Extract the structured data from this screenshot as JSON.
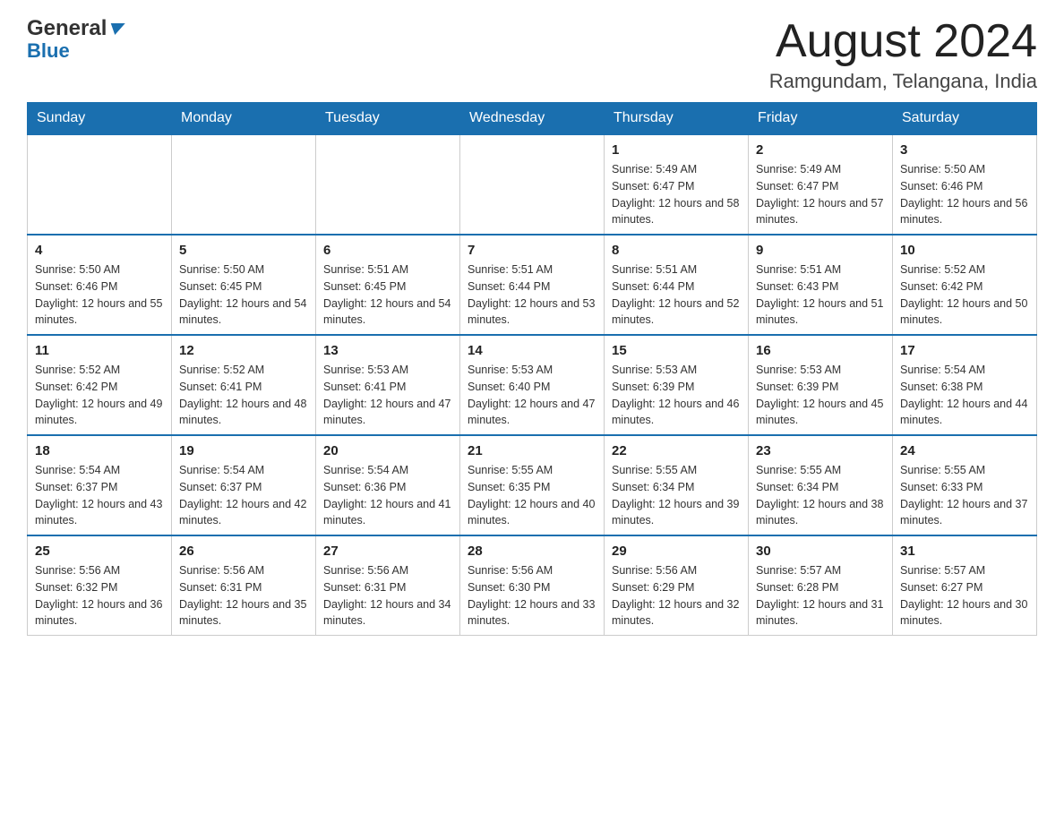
{
  "logo": {
    "general": "General",
    "blue": "Blue",
    "arrow_alt": "logo-arrow"
  },
  "header": {
    "title": "August 2024",
    "location": "Ramgundam, Telangana, India"
  },
  "weekdays": [
    "Sunday",
    "Monday",
    "Tuesday",
    "Wednesday",
    "Thursday",
    "Friday",
    "Saturday"
  ],
  "weeks": [
    {
      "days": [
        {
          "number": "",
          "sunrise": "",
          "sunset": "",
          "daylight": ""
        },
        {
          "number": "",
          "sunrise": "",
          "sunset": "",
          "daylight": ""
        },
        {
          "number": "",
          "sunrise": "",
          "sunset": "",
          "daylight": ""
        },
        {
          "number": "",
          "sunrise": "",
          "sunset": "",
          "daylight": ""
        },
        {
          "number": "1",
          "sunrise": "Sunrise: 5:49 AM",
          "sunset": "Sunset: 6:47 PM",
          "daylight": "Daylight: 12 hours and 58 minutes."
        },
        {
          "number": "2",
          "sunrise": "Sunrise: 5:49 AM",
          "sunset": "Sunset: 6:47 PM",
          "daylight": "Daylight: 12 hours and 57 minutes."
        },
        {
          "number": "3",
          "sunrise": "Sunrise: 5:50 AM",
          "sunset": "Sunset: 6:46 PM",
          "daylight": "Daylight: 12 hours and 56 minutes."
        }
      ]
    },
    {
      "days": [
        {
          "number": "4",
          "sunrise": "Sunrise: 5:50 AM",
          "sunset": "Sunset: 6:46 PM",
          "daylight": "Daylight: 12 hours and 55 minutes."
        },
        {
          "number": "5",
          "sunrise": "Sunrise: 5:50 AM",
          "sunset": "Sunset: 6:45 PM",
          "daylight": "Daylight: 12 hours and 54 minutes."
        },
        {
          "number": "6",
          "sunrise": "Sunrise: 5:51 AM",
          "sunset": "Sunset: 6:45 PM",
          "daylight": "Daylight: 12 hours and 54 minutes."
        },
        {
          "number": "7",
          "sunrise": "Sunrise: 5:51 AM",
          "sunset": "Sunset: 6:44 PM",
          "daylight": "Daylight: 12 hours and 53 minutes."
        },
        {
          "number": "8",
          "sunrise": "Sunrise: 5:51 AM",
          "sunset": "Sunset: 6:44 PM",
          "daylight": "Daylight: 12 hours and 52 minutes."
        },
        {
          "number": "9",
          "sunrise": "Sunrise: 5:51 AM",
          "sunset": "Sunset: 6:43 PM",
          "daylight": "Daylight: 12 hours and 51 minutes."
        },
        {
          "number": "10",
          "sunrise": "Sunrise: 5:52 AM",
          "sunset": "Sunset: 6:42 PM",
          "daylight": "Daylight: 12 hours and 50 minutes."
        }
      ]
    },
    {
      "days": [
        {
          "number": "11",
          "sunrise": "Sunrise: 5:52 AM",
          "sunset": "Sunset: 6:42 PM",
          "daylight": "Daylight: 12 hours and 49 minutes."
        },
        {
          "number": "12",
          "sunrise": "Sunrise: 5:52 AM",
          "sunset": "Sunset: 6:41 PM",
          "daylight": "Daylight: 12 hours and 48 minutes."
        },
        {
          "number": "13",
          "sunrise": "Sunrise: 5:53 AM",
          "sunset": "Sunset: 6:41 PM",
          "daylight": "Daylight: 12 hours and 47 minutes."
        },
        {
          "number": "14",
          "sunrise": "Sunrise: 5:53 AM",
          "sunset": "Sunset: 6:40 PM",
          "daylight": "Daylight: 12 hours and 47 minutes."
        },
        {
          "number": "15",
          "sunrise": "Sunrise: 5:53 AM",
          "sunset": "Sunset: 6:39 PM",
          "daylight": "Daylight: 12 hours and 46 minutes."
        },
        {
          "number": "16",
          "sunrise": "Sunrise: 5:53 AM",
          "sunset": "Sunset: 6:39 PM",
          "daylight": "Daylight: 12 hours and 45 minutes."
        },
        {
          "number": "17",
          "sunrise": "Sunrise: 5:54 AM",
          "sunset": "Sunset: 6:38 PM",
          "daylight": "Daylight: 12 hours and 44 minutes."
        }
      ]
    },
    {
      "days": [
        {
          "number": "18",
          "sunrise": "Sunrise: 5:54 AM",
          "sunset": "Sunset: 6:37 PM",
          "daylight": "Daylight: 12 hours and 43 minutes."
        },
        {
          "number": "19",
          "sunrise": "Sunrise: 5:54 AM",
          "sunset": "Sunset: 6:37 PM",
          "daylight": "Daylight: 12 hours and 42 minutes."
        },
        {
          "number": "20",
          "sunrise": "Sunrise: 5:54 AM",
          "sunset": "Sunset: 6:36 PM",
          "daylight": "Daylight: 12 hours and 41 minutes."
        },
        {
          "number": "21",
          "sunrise": "Sunrise: 5:55 AM",
          "sunset": "Sunset: 6:35 PM",
          "daylight": "Daylight: 12 hours and 40 minutes."
        },
        {
          "number": "22",
          "sunrise": "Sunrise: 5:55 AM",
          "sunset": "Sunset: 6:34 PM",
          "daylight": "Daylight: 12 hours and 39 minutes."
        },
        {
          "number": "23",
          "sunrise": "Sunrise: 5:55 AM",
          "sunset": "Sunset: 6:34 PM",
          "daylight": "Daylight: 12 hours and 38 minutes."
        },
        {
          "number": "24",
          "sunrise": "Sunrise: 5:55 AM",
          "sunset": "Sunset: 6:33 PM",
          "daylight": "Daylight: 12 hours and 37 minutes."
        }
      ]
    },
    {
      "days": [
        {
          "number": "25",
          "sunrise": "Sunrise: 5:56 AM",
          "sunset": "Sunset: 6:32 PM",
          "daylight": "Daylight: 12 hours and 36 minutes."
        },
        {
          "number": "26",
          "sunrise": "Sunrise: 5:56 AM",
          "sunset": "Sunset: 6:31 PM",
          "daylight": "Daylight: 12 hours and 35 minutes."
        },
        {
          "number": "27",
          "sunrise": "Sunrise: 5:56 AM",
          "sunset": "Sunset: 6:31 PM",
          "daylight": "Daylight: 12 hours and 34 minutes."
        },
        {
          "number": "28",
          "sunrise": "Sunrise: 5:56 AM",
          "sunset": "Sunset: 6:30 PM",
          "daylight": "Daylight: 12 hours and 33 minutes."
        },
        {
          "number": "29",
          "sunrise": "Sunrise: 5:56 AM",
          "sunset": "Sunset: 6:29 PM",
          "daylight": "Daylight: 12 hours and 32 minutes."
        },
        {
          "number": "30",
          "sunrise": "Sunrise: 5:57 AM",
          "sunset": "Sunset: 6:28 PM",
          "daylight": "Daylight: 12 hours and 31 minutes."
        },
        {
          "number": "31",
          "sunrise": "Sunrise: 5:57 AM",
          "sunset": "Sunset: 6:27 PM",
          "daylight": "Daylight: 12 hours and 30 minutes."
        }
      ]
    }
  ]
}
